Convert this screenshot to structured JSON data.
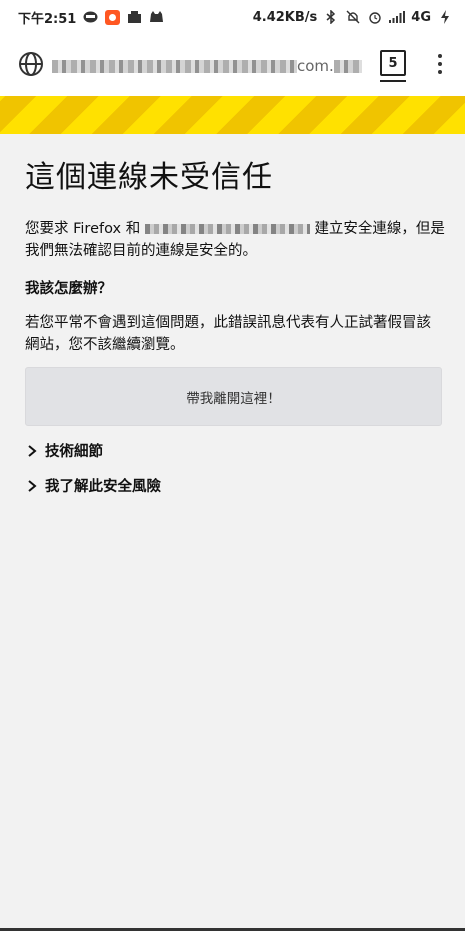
{
  "status_bar": {
    "time": "下午2:51",
    "net_speed": "4.42KB/s",
    "network": "4G",
    "icons": [
      "line-app-icon",
      "app-icon",
      "notification-icon",
      "game-icon",
      "bluetooth-icon",
      "silent-icon",
      "alarm-icon",
      "signal-icon",
      "charging-icon"
    ]
  },
  "toolbar": {
    "url_suffix": "com.",
    "tab_count": "5"
  },
  "error_page": {
    "title": "這個連線未受信任",
    "intro_prefix": "您要求 Firefox 和",
    "intro_suffix": "建立安全連線，但是我們無法確認目前的連線是安全的。",
    "question": "我該怎麼辦？",
    "advice": "若您平常不會遇到這個問題，此錯誤訊息代表有人正試著假冒該網站，您不該繼續瀏覽。",
    "leave_button": "帶我離開這裡！",
    "tech_details": "技術細節",
    "understand_risks": "我了解此安全風險"
  },
  "colors": {
    "stripe_yellow": "#ffe100",
    "stripe_dark": "#f0c400",
    "progress_green": "#46a142",
    "button_bg": "#e1e2e5"
  }
}
